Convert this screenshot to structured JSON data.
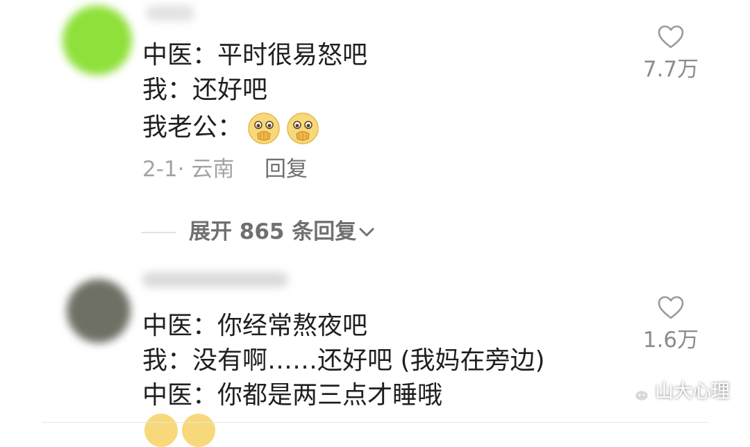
{
  "comments": [
    {
      "lines": [
        "中医：平时很易怒吧",
        "我：还好吧",
        "我老公："
      ],
      "meta": "2-1· 云南",
      "reply_label": "回复",
      "likes": "7.7万",
      "expand_replies": "展开 865 条回复"
    },
    {
      "lines": [
        "中医：你经常熬夜吧",
        "我：没有啊……还好吧 (我妈在旁边)",
        "中医：你都是两三点才睡哦"
      ],
      "likes": "1.6万"
    }
  ],
  "icons": {
    "like": "heart-outline-icon",
    "expand": "chevron-down-icon",
    "reaction_emoji": "face-with-hand-over-mouth-emoji",
    "watermark": "wechat-icon"
  },
  "watermark": {
    "text": "山大心理"
  },
  "colors": {
    "primary_text": "#1f1f1f",
    "meta_text": "#a3a3a3",
    "like_count": "#8c8c8c",
    "avatar_1": "#8fe03a",
    "avatar_2": "#6e7065",
    "emoji_face": "#f7d97b"
  }
}
